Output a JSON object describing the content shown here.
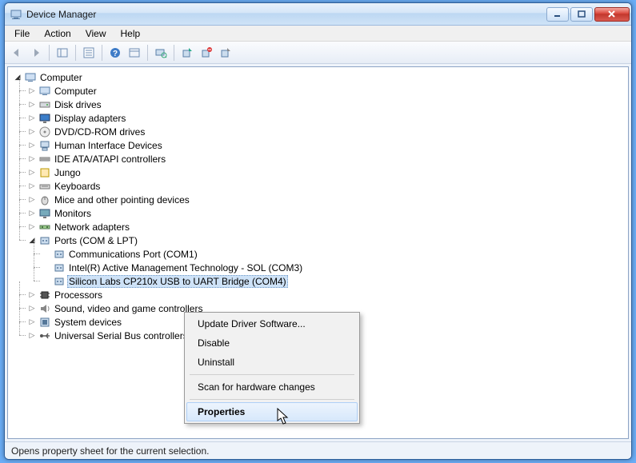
{
  "window": {
    "title": "Device Manager"
  },
  "menubar": {
    "file": "File",
    "action": "Action",
    "view": "View",
    "help": "Help"
  },
  "tree": {
    "root": "Computer",
    "categories": [
      "Computer",
      "Disk drives",
      "Display adapters",
      "DVD/CD-ROM drives",
      "Human Interface Devices",
      "IDE ATA/ATAPI controllers",
      "Jungo",
      "Keyboards",
      "Mice and other pointing devices",
      "Monitors",
      "Network adapters",
      "Ports (COM & LPT)",
      "Processors",
      "Sound, video and game controllers",
      "System devices",
      "Universal Serial Bus controllers"
    ],
    "ports_children": [
      "Communications Port (COM1)",
      "Intel(R) Active Management Technology - SOL (COM3)",
      "Silicon Labs CP210x USB to UART Bridge (COM4)"
    ],
    "selected": "Silicon Labs CP210x USB to UART Bridge (COM4)"
  },
  "context_menu": {
    "update": "Update Driver Software...",
    "disable": "Disable",
    "uninstall": "Uninstall",
    "scan": "Scan for hardware changes",
    "properties": "Properties"
  },
  "statusbar": {
    "text": "Opens property sheet for the current selection."
  }
}
